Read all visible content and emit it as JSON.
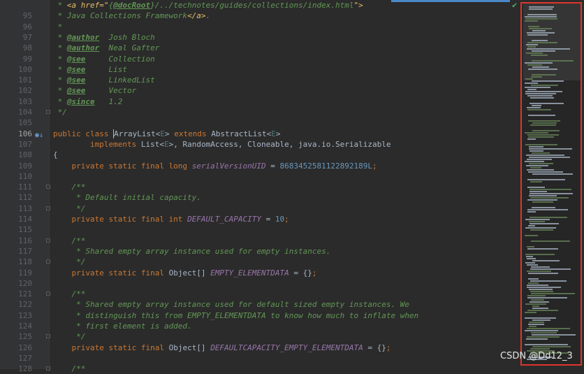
{
  "editor": {
    "inspection_status_icon": "check-icon",
    "lines": [
      {
        "num": "",
        "tokens": [
          {
            "t": " * ",
            "k": "doc"
          },
          {
            "t": "<a href=\"",
            "k": "html"
          },
          {
            "t": "{",
            "k": "doc"
          },
          {
            "t": "@docRoot",
            "k": "tag"
          },
          {
            "t": "}/../technotes/guides/collections/index.html",
            "k": "doc"
          },
          {
            "t": "\">",
            "k": "html"
          }
        ]
      },
      {
        "num": "95",
        "tokens": [
          {
            "t": " * Java Collections Framework",
            "k": "doc"
          },
          {
            "t": "</a>",
            "k": "html"
          },
          {
            "t": ".",
            "k": "doc"
          }
        ]
      },
      {
        "num": "96",
        "tokens": [
          {
            "t": " *",
            "k": "doc"
          }
        ]
      },
      {
        "num": "97",
        "tokens": [
          {
            "t": " * ",
            "k": "doc"
          },
          {
            "t": "@author",
            "k": "tag"
          },
          {
            "t": "  Josh Bloch",
            "k": "doc"
          }
        ]
      },
      {
        "num": "98",
        "tokens": [
          {
            "t": " * ",
            "k": "doc"
          },
          {
            "t": "@author",
            "k": "tag"
          },
          {
            "t": "  Neal Gafter",
            "k": "doc"
          }
        ]
      },
      {
        "num": "99",
        "tokens": [
          {
            "t": " * ",
            "k": "doc"
          },
          {
            "t": "@see",
            "k": "tag"
          },
          {
            "t": "     Collection",
            "k": "ref"
          }
        ]
      },
      {
        "num": "100",
        "tokens": [
          {
            "t": " * ",
            "k": "doc"
          },
          {
            "t": "@see",
            "k": "tag"
          },
          {
            "t": "     List",
            "k": "ref"
          }
        ]
      },
      {
        "num": "101",
        "tokens": [
          {
            "t": " * ",
            "k": "doc"
          },
          {
            "t": "@see",
            "k": "tag"
          },
          {
            "t": "     LinkedList",
            "k": "ref"
          }
        ]
      },
      {
        "num": "102",
        "tokens": [
          {
            "t": " * ",
            "k": "doc"
          },
          {
            "t": "@see",
            "k": "tag"
          },
          {
            "t": "     Vector",
            "k": "ref"
          }
        ]
      },
      {
        "num": "103",
        "tokens": [
          {
            "t": " * ",
            "k": "doc"
          },
          {
            "t": "@since",
            "k": "tag"
          },
          {
            "t": "   1.2",
            "k": "doc"
          }
        ]
      },
      {
        "num": "104",
        "fold": true,
        "tokens": [
          {
            "t": " */",
            "k": "doc"
          }
        ]
      },
      {
        "num": "105",
        "tokens": []
      },
      {
        "num": "106",
        "current": true,
        "marker": "class-override-icon",
        "tokens": [
          {
            "t": "public class ",
            "k": "kw"
          },
          {
            "t": "A",
            "k": "caret"
          },
          {
            "t": "rrayList<",
            "k": "plain"
          },
          {
            "t": "E",
            "k": "gen"
          },
          {
            "t": "> ",
            "k": "plain"
          },
          {
            "t": "extends ",
            "k": "kw"
          },
          {
            "t": "AbstractList<",
            "k": "plain"
          },
          {
            "t": "E",
            "k": "gen"
          },
          {
            "t": ">",
            "k": "plain"
          }
        ]
      },
      {
        "num": "107",
        "tokens": [
          {
            "t": "        implements ",
            "k": "kw"
          },
          {
            "t": "List<",
            "k": "plain"
          },
          {
            "t": "E",
            "k": "gen"
          },
          {
            "t": ">, RandomAccess, Cloneable, java.io.Serializable",
            "k": "plain"
          }
        ]
      },
      {
        "num": "108",
        "tokens": [
          {
            "t": "{",
            "k": "plain"
          }
        ]
      },
      {
        "num": "109",
        "tokens": [
          {
            "t": "    private static final long ",
            "k": "kw"
          },
          {
            "t": "serialVersionUID",
            "k": "field"
          },
          {
            "t": " = ",
            "k": "plain"
          },
          {
            "t": "8683452581122892189L",
            "k": "num"
          },
          {
            "t": ";",
            "k": "kw"
          }
        ]
      },
      {
        "num": "110",
        "tokens": []
      },
      {
        "num": "111",
        "fold": true,
        "tokens": [
          {
            "t": "    /**",
            "k": "doc"
          }
        ]
      },
      {
        "num": "112",
        "tokens": [
          {
            "t": "     * Default initial capacity.",
            "k": "doc"
          }
        ]
      },
      {
        "num": "113",
        "fold": true,
        "tokens": [
          {
            "t": "     */",
            "k": "doc"
          }
        ]
      },
      {
        "num": "114",
        "tokens": [
          {
            "t": "    private static final int ",
            "k": "kw"
          },
          {
            "t": "DEFAULT_CAPACITY",
            "k": "field"
          },
          {
            "t": " = ",
            "k": "plain"
          },
          {
            "t": "10",
            "k": "num"
          },
          {
            "t": ";",
            "k": "kw"
          }
        ]
      },
      {
        "num": "115",
        "tokens": []
      },
      {
        "num": "116",
        "fold": true,
        "tokens": [
          {
            "t": "    /**",
            "k": "doc"
          }
        ]
      },
      {
        "num": "117",
        "tokens": [
          {
            "t": "     * Shared empty array instance used for empty instances.",
            "k": "doc"
          }
        ]
      },
      {
        "num": "118",
        "fold": true,
        "tokens": [
          {
            "t": "     */",
            "k": "doc"
          }
        ]
      },
      {
        "num": "119",
        "tokens": [
          {
            "t": "    private static final ",
            "k": "kw"
          },
          {
            "t": "Object[] ",
            "k": "plain"
          },
          {
            "t": "EMPTY_ELEMENTDATA",
            "k": "field"
          },
          {
            "t": " = {}",
            "k": "plain"
          },
          {
            "t": ";",
            "k": "kw"
          }
        ]
      },
      {
        "num": "120",
        "tokens": []
      },
      {
        "num": "121",
        "fold": true,
        "tokens": [
          {
            "t": "    /**",
            "k": "doc"
          }
        ]
      },
      {
        "num": "122",
        "tokens": [
          {
            "t": "     * Shared empty array instance used for default sized empty instances. We",
            "k": "doc"
          }
        ]
      },
      {
        "num": "123",
        "tokens": [
          {
            "t": "     * distinguish this from EMPTY_ELEMENTDATA to know how much to inflate when",
            "k": "doc"
          }
        ]
      },
      {
        "num": "124",
        "tokens": [
          {
            "t": "     * first element is added.",
            "k": "doc"
          }
        ]
      },
      {
        "num": "125",
        "fold": true,
        "tokens": [
          {
            "t": "     */",
            "k": "doc"
          }
        ]
      },
      {
        "num": "126",
        "tokens": [
          {
            "t": "    private static final ",
            "k": "kw"
          },
          {
            "t": "Object[] ",
            "k": "plain"
          },
          {
            "t": "DEFAULTCAPACITY_EMPTY_ELEMENTDATA",
            "k": "field"
          },
          {
            "t": " = {}",
            "k": "plain"
          },
          {
            "t": ";",
            "k": "kw"
          }
        ]
      },
      {
        "num": "127",
        "tokens": []
      },
      {
        "num": "128",
        "fold": true,
        "tokens": [
          {
            "t": "    /**",
            "k": "doc"
          }
        ]
      }
    ]
  },
  "minimap": {
    "highlight_color": "#e0352b"
  },
  "watermark": {
    "text": "CSDN @Dd12_3"
  }
}
